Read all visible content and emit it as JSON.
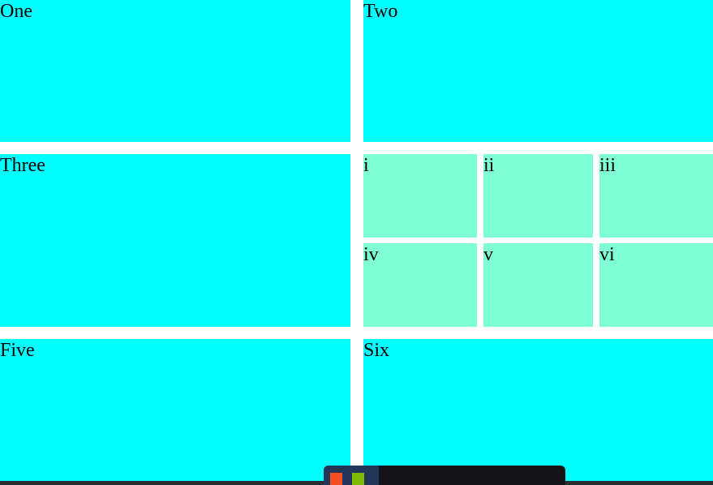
{
  "cells": {
    "one": "One",
    "two": "Two",
    "three": "Three",
    "five": "Five",
    "six": "Six"
  },
  "nested": [
    "i",
    "ii",
    "iii",
    "iv",
    "v",
    "vi"
  ],
  "colors": {
    "outer": "#00ffff",
    "nested": "#7fffd4"
  },
  "taskbar": {
    "logo_icon": "windows-logo-icon"
  }
}
